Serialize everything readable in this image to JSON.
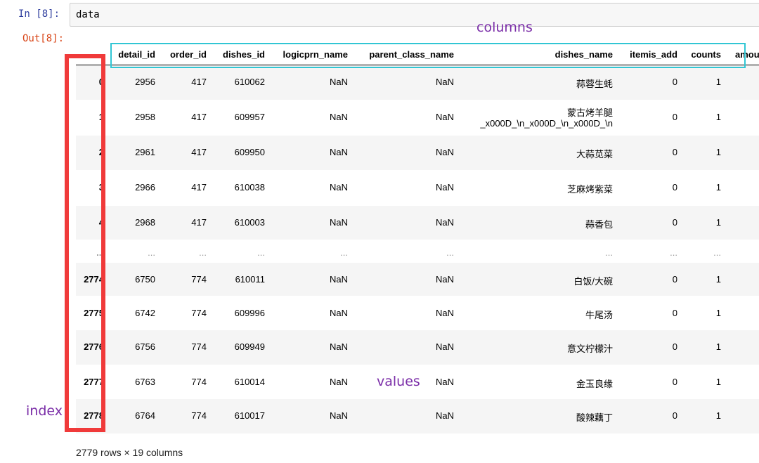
{
  "cell": {
    "in_prompt": "In  [8]:",
    "code": "data",
    "out_prompt": "Out[8]:"
  },
  "table": {
    "columns": [
      "",
      "detail_id",
      "order_id",
      "dishes_id",
      "logicprn_name",
      "parent_class_name",
      "dishes_name",
      "itemis_add",
      "counts",
      "amou"
    ],
    "rows": [
      [
        "0",
        "2956",
        "417",
        "610062",
        "NaN",
        "NaN",
        "蒜蓉生蚝",
        "0",
        "1"
      ],
      [
        "1",
        "2958",
        "417",
        "609957",
        "NaN",
        "NaN",
        "蒙古烤羊腿\n_x000D_\\n_x000D_\\n_x000D_\\n",
        "0",
        "1"
      ],
      [
        "2",
        "2961",
        "417",
        "609950",
        "NaN",
        "NaN",
        "大蒜苋菜",
        "0",
        "1"
      ],
      [
        "3",
        "2966",
        "417",
        "610038",
        "NaN",
        "NaN",
        "芝麻烤紫菜",
        "0",
        "1"
      ],
      [
        "4",
        "2968",
        "417",
        "610003",
        "NaN",
        "NaN",
        "蒜香包",
        "0",
        "1"
      ],
      [
        "...",
        "...",
        "...",
        "...",
        "...",
        "...",
        "...",
        "...",
        "..."
      ],
      [
        "2774",
        "6750",
        "774",
        "610011",
        "NaN",
        "NaN",
        "白饭/大碗",
        "0",
        "1"
      ],
      [
        "2775",
        "6742",
        "774",
        "609996",
        "NaN",
        "NaN",
        "牛尾汤",
        "0",
        "1"
      ],
      [
        "2776",
        "6756",
        "774",
        "609949",
        "NaN",
        "NaN",
        "意文柠檬汁",
        "0",
        "1"
      ],
      [
        "2777",
        "6763",
        "774",
        "610014",
        "NaN",
        "NaN",
        "金玉良缘",
        "0",
        "1"
      ],
      [
        "2778",
        "6764",
        "774",
        "610017",
        "NaN",
        "NaN",
        "酸辣藕丁",
        "0",
        "1"
      ]
    ],
    "footer": "2779 rows × 19 columns"
  },
  "annotations": {
    "columns": "columns",
    "values": "values",
    "index": "index"
  },
  "colors": {
    "index_box": "#f03a3a",
    "columns_box": "#31c6d4",
    "annotation_text": "#7b2ea8",
    "in_prompt": "#303f9f",
    "out_prompt": "#d84315"
  }
}
